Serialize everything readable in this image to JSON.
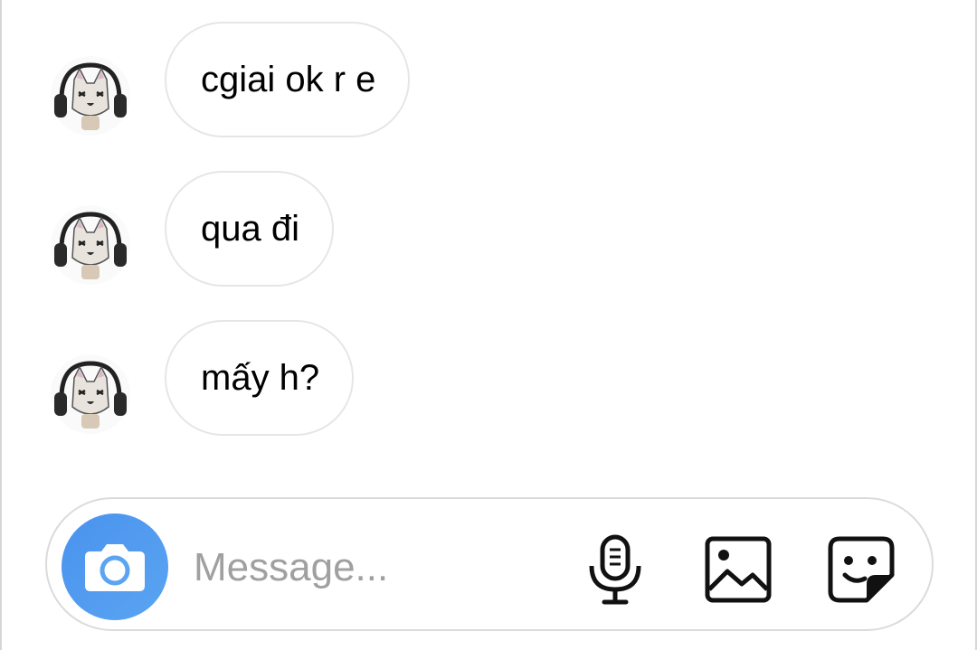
{
  "messages": [
    {
      "text": "cgiai ok r e"
    },
    {
      "text": "qua đi"
    },
    {
      "text": "mấy h?"
    }
  ],
  "composer": {
    "placeholder": "Message...",
    "accent_color": "#4a93ee"
  },
  "icons": {
    "camera": "camera-icon",
    "mic": "microphone-icon",
    "gallery": "image-icon",
    "sticker": "sticker-icon"
  }
}
